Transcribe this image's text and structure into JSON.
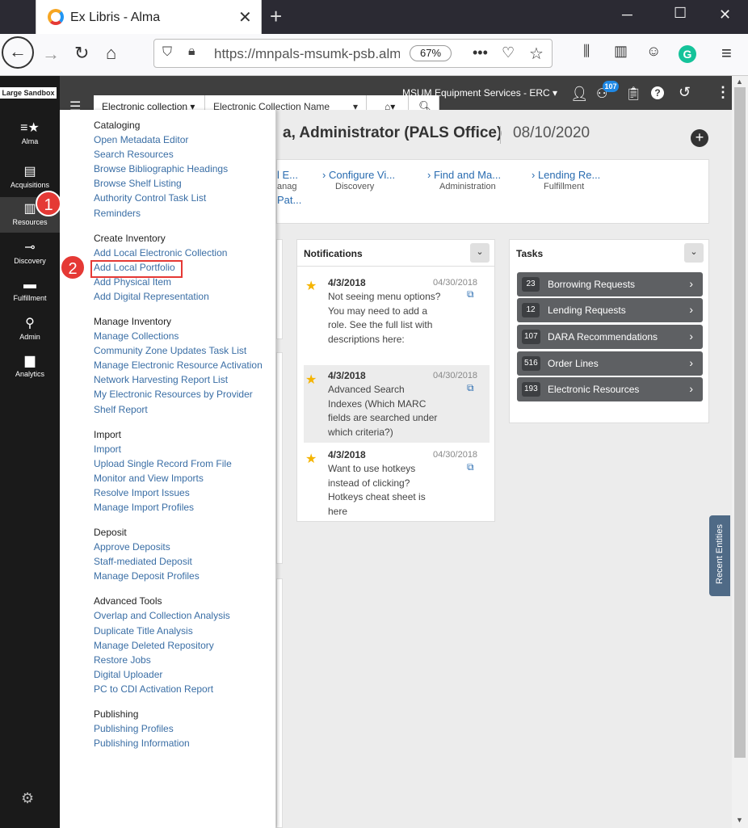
{
  "browser": {
    "tab_title": "Ex Libris - Alma",
    "url": "https://mnpals-msumk-psb.alm",
    "zoom": "67%"
  },
  "app": {
    "sandbox_label": "Large Sandbox",
    "institution": "MSUM Equipment Services - ERC",
    "notif_count": "107"
  },
  "sidebar": {
    "items": [
      {
        "label": "Alma"
      },
      {
        "label": "Acquisitions"
      },
      {
        "label": "Resources"
      },
      {
        "label": "Discovery"
      },
      {
        "label": "Fulfillment"
      },
      {
        "label": "Admin"
      },
      {
        "label": "Analytics"
      }
    ]
  },
  "search": {
    "type": "Electronic collection",
    "field": "Electronic Collection Name"
  },
  "menu": {
    "sections": [
      {
        "heading": "Cataloging",
        "items": [
          "Open Metadata Editor",
          "Search Resources",
          "Browse Bibliographic Headings",
          "Browse Shelf Listing",
          "Authority Control Task List",
          "Reminders"
        ]
      },
      {
        "heading": "Create Inventory",
        "items": [
          "Add Local Electronic Collection",
          "Add Local Portfolio",
          "Add Physical Item",
          "Add Digital Representation"
        ]
      },
      {
        "heading": "Manage Inventory",
        "items": [
          "Manage Collections",
          "Community Zone Updates Task List",
          "Manage Electronic Resource Activation",
          "Network Harvesting Report List",
          "My Electronic Resources by Provider",
          "Shelf Report"
        ]
      },
      {
        "heading": "Import",
        "items": [
          "Import",
          "Upload Single Record From File",
          "Monitor and View Imports",
          "Resolve Import Issues",
          "Manage Import Profiles"
        ]
      },
      {
        "heading": "Deposit",
        "items": [
          "Approve Deposits",
          "Staff-mediated Deposit",
          "Manage Deposit Profiles"
        ]
      },
      {
        "heading": "Advanced Tools",
        "items": [
          "Overlap and Collection Analysis",
          "Duplicate Title Analysis",
          "Manage Deleted Repository",
          "Restore Jobs",
          "Digital Uploader",
          "PC to CDI Activation Report"
        ]
      },
      {
        "heading": "Publishing",
        "items": [
          "Publishing Profiles",
          "Publishing Information"
        ]
      }
    ]
  },
  "callouts": [
    "1",
    "2"
  ],
  "main": {
    "greeting": "a, Administrator (PALS Office)",
    "date": "08/10/2020",
    "quicklinks": [
      {
        "label": "l E...",
        "sub": "anag"
      },
      {
        "label": "Configure Vi...",
        "sub": "Discovery"
      },
      {
        "label": "Find and Ma...",
        "sub": "Administration"
      },
      {
        "label": "Lending Re...",
        "sub": "Fulfillment"
      },
      {
        "label": "Pat...",
        "sub": ""
      }
    ]
  },
  "notifications": {
    "title": "Notifications",
    "items": [
      {
        "date": "4/3/2018",
        "date2": "04/30/2018",
        "text": "Not seeing menu options? You may need to add a role. See the full list with descriptions here:"
      },
      {
        "date": "4/3/2018",
        "date2": "04/30/2018",
        "text": "Advanced Search Indexes (Which MARC fields are searched under which criteria?)"
      },
      {
        "date": "4/3/2018",
        "date2": "04/30/2018",
        "text": "Want to use hotkeys instead of clicking? Hotkeys cheat sheet is here"
      }
    ]
  },
  "tasks": {
    "title": "Tasks",
    "items": [
      {
        "count": "23",
        "label": "Borrowing Requests"
      },
      {
        "count": "12",
        "label": "Lending Requests"
      },
      {
        "count": "107",
        "label": "DARA Recommendations"
      },
      {
        "count": "516",
        "label": "Order Lines"
      },
      {
        "count": "193",
        "label": "Electronic Resources"
      }
    ]
  },
  "recent_label": "Recent Entities"
}
